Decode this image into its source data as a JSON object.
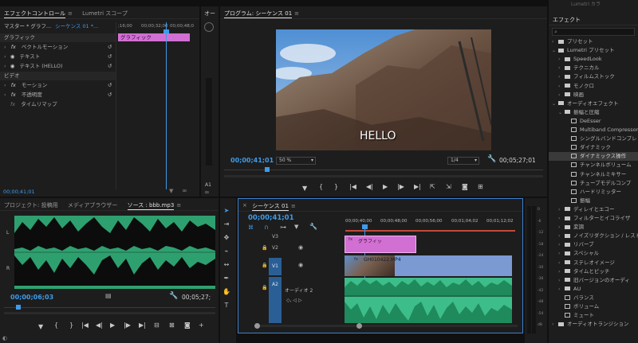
{
  "effect_controls": {
    "tabs": [
      "エフェクトコントロール",
      "Lumetri スコープ"
    ],
    "master_label": "マスター * グラフ...",
    "sequence_label": "シーケンス 01 *...",
    "ruler_ticks": [
      ";16;00",
      "00;00;32;00",
      "00;00;48;0"
    ],
    "clip_label": "グラフィック",
    "section_graphic": "グラフィック",
    "rows": [
      {
        "label": "ベクトルモーション",
        "icon": "fx"
      },
      {
        "label": "テキスト",
        "icon": "eye"
      },
      {
        "label": "テキスト (HELLO)",
        "icon": "eye"
      }
    ],
    "section_video": "ビデオ",
    "video_rows": [
      {
        "label": "モーション",
        "icon": "fx"
      },
      {
        "label": "不透明度",
        "icon": "fx"
      },
      {
        "label": "タイムリマップ",
        "icon": "fx"
      }
    ],
    "timecode": "00;00;41;01"
  },
  "audio_meter": {
    "tab": "オー",
    "labels": [
      "0",
      "-6",
      "-12",
      "-18",
      "-24",
      "-30",
      "-36",
      "-42",
      "-48",
      "-54",
      "dB"
    ],
    "a1": "A1"
  },
  "program": {
    "title": "プログラム: シーケンス 01",
    "overlay_text": "HELLO",
    "timecode": "00;00;41;01",
    "zoom": "50 %",
    "quality": "1/4",
    "duration": "00;05;27;01"
  },
  "effects": {
    "top_label": "Lumetri カラ",
    "title": "エフェクト",
    "items": [
      {
        "label": "プリセット",
        "type": "folder",
        "indent": 0,
        "open": false
      },
      {
        "label": "Lumetri プリセット",
        "type": "folder",
        "indent": 0,
        "open": true
      },
      {
        "label": "SpeedLook",
        "type": "folder",
        "indent": 1,
        "open": false
      },
      {
        "label": "テクニカル",
        "type": "folder",
        "indent": 1,
        "open": false
      },
      {
        "label": "フィルムストック",
        "type": "folder",
        "indent": 1,
        "open": false
      },
      {
        "label": "モノクロ",
        "type": "folder",
        "indent": 1,
        "open": false
      },
      {
        "label": "映画",
        "type": "folder",
        "indent": 1,
        "open": false
      },
      {
        "label": "オーディオエフェクト",
        "type": "folder",
        "indent": 0,
        "open": true
      },
      {
        "label": "振幅と圧縮",
        "type": "folder",
        "indent": 1,
        "open": true
      },
      {
        "label": "DeEsser",
        "type": "fx",
        "indent": 2
      },
      {
        "label": "Multiband Compressor",
        "type": "fx",
        "indent": 2
      },
      {
        "label": "シングルバンドコンプレ",
        "type": "fx",
        "indent": 2
      },
      {
        "label": "ダイナミック",
        "type": "fx",
        "indent": 2
      },
      {
        "label": "ダイナミックス操作",
        "type": "fx",
        "indent": 2,
        "selected": true
      },
      {
        "label": "チャンネルボリューム",
        "type": "fx",
        "indent": 2
      },
      {
        "label": "チャンネルミキサー",
        "type": "fx",
        "indent": 2
      },
      {
        "label": "チューブモデルコンプ",
        "type": "fx",
        "indent": 2
      },
      {
        "label": "ハードリミッター",
        "type": "fx",
        "indent": 2
      },
      {
        "label": "振幅",
        "type": "fx",
        "indent": 2
      },
      {
        "label": "ディレイとエコー",
        "type": "folder",
        "indent": 1,
        "open": false
      },
      {
        "label": "フィルターとイコライザ",
        "type": "folder",
        "indent": 1,
        "open": false
      },
      {
        "label": "変調",
        "type": "folder",
        "indent": 1,
        "open": false
      },
      {
        "label": "ノイズリダクション / レスト",
        "type": "folder",
        "indent": 1,
        "open": false
      },
      {
        "label": "リバーブ",
        "type": "folder",
        "indent": 1,
        "open": false
      },
      {
        "label": "スペシャル",
        "type": "folder",
        "indent": 1,
        "open": false
      },
      {
        "label": "ステレオイメージ",
        "type": "folder",
        "indent": 1,
        "open": false
      },
      {
        "label": "タイムとピッチ",
        "type": "folder",
        "indent": 1,
        "open": false
      },
      {
        "label": "旧バージョンのオーディ",
        "type": "folder",
        "indent": 1,
        "open": false
      },
      {
        "label": "AU",
        "type": "folder",
        "indent": 1,
        "open": false
      },
      {
        "label": "バランス",
        "type": "fx",
        "indent": 1
      },
      {
        "label": "ボリューム",
        "type": "fx",
        "indent": 1
      },
      {
        "label": "ミュート",
        "type": "fx",
        "indent": 1
      },
      {
        "label": "オーディオトランジション",
        "type": "folder",
        "indent": 0,
        "open": false
      }
    ]
  },
  "source": {
    "tabs": [
      "プロジェクト: 投稿用",
      "メディアブラウザー",
      "ソース : bbb.mp3"
    ],
    "timecode": "00;00;06;03",
    "duration": "00;05;27;",
    "channel_labels": [
      "L",
      "R"
    ]
  },
  "timeline": {
    "title": "シーケンス 01",
    "timecode": "00;00;41;01",
    "ruler": [
      "00;00;40;00",
      "00;00;48;00",
      "00;00;56;00",
      "00;01;04;02",
      "00;01;12;02"
    ],
    "tracks": {
      "v3": "V3",
      "v2": "V2",
      "v1": "V1",
      "a1": "A1",
      "a2": "A2"
    },
    "graphic_clip": "グラフィッ",
    "video_clip": "GH010422.MP4",
    "audio2_label": "オーディオ 2",
    "colors": {
      "graphic": "#d26fd3",
      "video": "#7b9ad3",
      "audio": "#3dbd8a",
      "accent": "#3d9be9"
    }
  }
}
